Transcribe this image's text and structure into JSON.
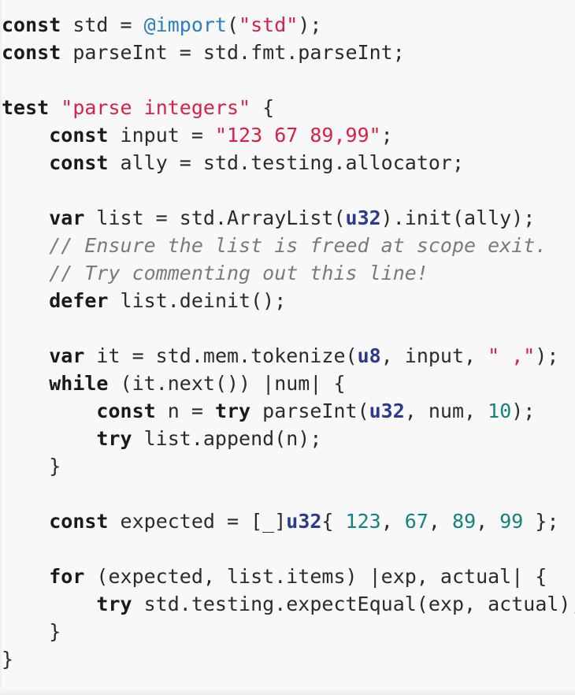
{
  "editor": {
    "language": "zig",
    "background_color": "#f8f8f8",
    "font_size_px": 25,
    "line_height_px": 35,
    "indent_spaces": 4
  },
  "theme": {
    "plain": "#2b2b2b",
    "keyword": "#1a1a1a",
    "builtin": "#2a7fc4",
    "string": "#d62246",
    "type": "#2a3a8c",
    "number": "#178080",
    "comment": "#7a7a7a"
  },
  "lines": [
    {
      "index": 1,
      "text": "const std = @import(\"std\");",
      "tokens": [
        {
          "t": "const",
          "k": "keyword"
        },
        {
          "t": " std = ",
          "k": "plain"
        },
        {
          "t": "@import",
          "k": "builtin"
        },
        {
          "t": "(",
          "k": "punct"
        },
        {
          "t": "\"std\"",
          "k": "string"
        },
        {
          "t": ");",
          "k": "punct"
        }
      ]
    },
    {
      "index": 2,
      "text": "const parseInt = std.fmt.parseInt;",
      "tokens": [
        {
          "t": "const",
          "k": "keyword"
        },
        {
          "t": " parseInt = std.fmt.parseInt;",
          "k": "plain"
        }
      ]
    },
    {
      "index": 3,
      "text": "",
      "tokens": []
    },
    {
      "index": 4,
      "text": "test \"parse integers\" {",
      "tokens": [
        {
          "t": "test",
          "k": "keyword"
        },
        {
          "t": " ",
          "k": "plain"
        },
        {
          "t": "\"parse integers\"",
          "k": "string"
        },
        {
          "t": " {",
          "k": "punct"
        }
      ]
    },
    {
      "index": 5,
      "text": "    const input = \"123 67 89,99\";",
      "tokens": [
        {
          "t": "    ",
          "k": "plain"
        },
        {
          "t": "const",
          "k": "keyword"
        },
        {
          "t": " input = ",
          "k": "plain"
        },
        {
          "t": "\"123 67 89,99\"",
          "k": "string"
        },
        {
          "t": ";",
          "k": "punct"
        }
      ]
    },
    {
      "index": 6,
      "text": "    const ally = std.testing.allocator;",
      "tokens": [
        {
          "t": "    ",
          "k": "plain"
        },
        {
          "t": "const",
          "k": "keyword"
        },
        {
          "t": " ally = std.testing.allocator;",
          "k": "plain"
        }
      ]
    },
    {
      "index": 7,
      "text": "",
      "tokens": []
    },
    {
      "index": 8,
      "text": "    var list = std.ArrayList(u32).init(ally);",
      "tokens": [
        {
          "t": "    ",
          "k": "plain"
        },
        {
          "t": "var",
          "k": "keyword"
        },
        {
          "t": " list = std.ArrayList(",
          "k": "plain"
        },
        {
          "t": "u32",
          "k": "type"
        },
        {
          "t": ").init(ally);",
          "k": "plain"
        }
      ]
    },
    {
      "index": 9,
      "text": "    // Ensure the list is freed at scope exit.",
      "tokens": [
        {
          "t": "    ",
          "k": "plain"
        },
        {
          "t": "// Ensure the list is freed at scope exit.",
          "k": "comment"
        }
      ]
    },
    {
      "index": 10,
      "text": "    // Try commenting out this line!",
      "tokens": [
        {
          "t": "    ",
          "k": "plain"
        },
        {
          "t": "// Try commenting out this line!",
          "k": "comment"
        }
      ]
    },
    {
      "index": 11,
      "text": "    defer list.deinit();",
      "tokens": [
        {
          "t": "    ",
          "k": "plain"
        },
        {
          "t": "defer",
          "k": "keyword"
        },
        {
          "t": " list.deinit();",
          "k": "plain"
        }
      ]
    },
    {
      "index": 12,
      "text": "",
      "tokens": []
    },
    {
      "index": 13,
      "text": "    var it = std.mem.tokenize(u8, input, \" ,\");",
      "tokens": [
        {
          "t": "    ",
          "k": "plain"
        },
        {
          "t": "var",
          "k": "keyword"
        },
        {
          "t": " it = std.mem.tokenize(",
          "k": "plain"
        },
        {
          "t": "u8",
          "k": "type"
        },
        {
          "t": ", input, ",
          "k": "plain"
        },
        {
          "t": "\" ,\"",
          "k": "string"
        },
        {
          "t": ");",
          "k": "punct"
        }
      ]
    },
    {
      "index": 14,
      "text": "    while (it.next()) |num| {",
      "tokens": [
        {
          "t": "    ",
          "k": "plain"
        },
        {
          "t": "while",
          "k": "keyword"
        },
        {
          "t": " (it.next()) |num| {",
          "k": "plain"
        }
      ]
    },
    {
      "index": 15,
      "text": "        const n = try parseInt(u32, num, 10);",
      "tokens": [
        {
          "t": "        ",
          "k": "plain"
        },
        {
          "t": "const",
          "k": "keyword"
        },
        {
          "t": " n = ",
          "k": "plain"
        },
        {
          "t": "try",
          "k": "keyword"
        },
        {
          "t": " parseInt(",
          "k": "plain"
        },
        {
          "t": "u32",
          "k": "type"
        },
        {
          "t": ", num, ",
          "k": "plain"
        },
        {
          "t": "10",
          "k": "number"
        },
        {
          "t": ");",
          "k": "punct"
        }
      ]
    },
    {
      "index": 16,
      "text": "        try list.append(n);",
      "tokens": [
        {
          "t": "        ",
          "k": "plain"
        },
        {
          "t": "try",
          "k": "keyword"
        },
        {
          "t": " list.append(n);",
          "k": "plain"
        }
      ]
    },
    {
      "index": 17,
      "text": "    }",
      "tokens": [
        {
          "t": "    }",
          "k": "plain"
        }
      ]
    },
    {
      "index": 18,
      "text": "",
      "tokens": []
    },
    {
      "index": 19,
      "text": "    const expected = [_]u32{ 123, 67, 89, 99 };",
      "tokens": [
        {
          "t": "    ",
          "k": "plain"
        },
        {
          "t": "const",
          "k": "keyword"
        },
        {
          "t": " expected = [_]",
          "k": "plain"
        },
        {
          "t": "u32",
          "k": "type"
        },
        {
          "t": "{ ",
          "k": "plain"
        },
        {
          "t": "123",
          "k": "number"
        },
        {
          "t": ", ",
          "k": "plain"
        },
        {
          "t": "67",
          "k": "number"
        },
        {
          "t": ", ",
          "k": "plain"
        },
        {
          "t": "89",
          "k": "number"
        },
        {
          "t": ", ",
          "k": "plain"
        },
        {
          "t": "99",
          "k": "number"
        },
        {
          "t": " };",
          "k": "plain"
        }
      ]
    },
    {
      "index": 20,
      "text": "",
      "tokens": []
    },
    {
      "index": 21,
      "text": "    for (expected, list.items) |exp, actual| {",
      "tokens": [
        {
          "t": "    ",
          "k": "plain"
        },
        {
          "t": "for",
          "k": "keyword"
        },
        {
          "t": " (expected, list.items) |exp, actual| {",
          "k": "plain"
        }
      ]
    },
    {
      "index": 22,
      "text": "        try std.testing.expectEqual(exp, actual);",
      "tokens": [
        {
          "t": "        ",
          "k": "plain"
        },
        {
          "t": "try",
          "k": "keyword"
        },
        {
          "t": " std.testing.expectEqual(exp, actual);",
          "k": "plain"
        }
      ]
    },
    {
      "index": 23,
      "text": "    }",
      "tokens": [
        {
          "t": "    }",
          "k": "plain"
        }
      ]
    },
    {
      "index": 24,
      "text": "}",
      "tokens": [
        {
          "t": "}",
          "k": "plain"
        }
      ]
    }
  ]
}
